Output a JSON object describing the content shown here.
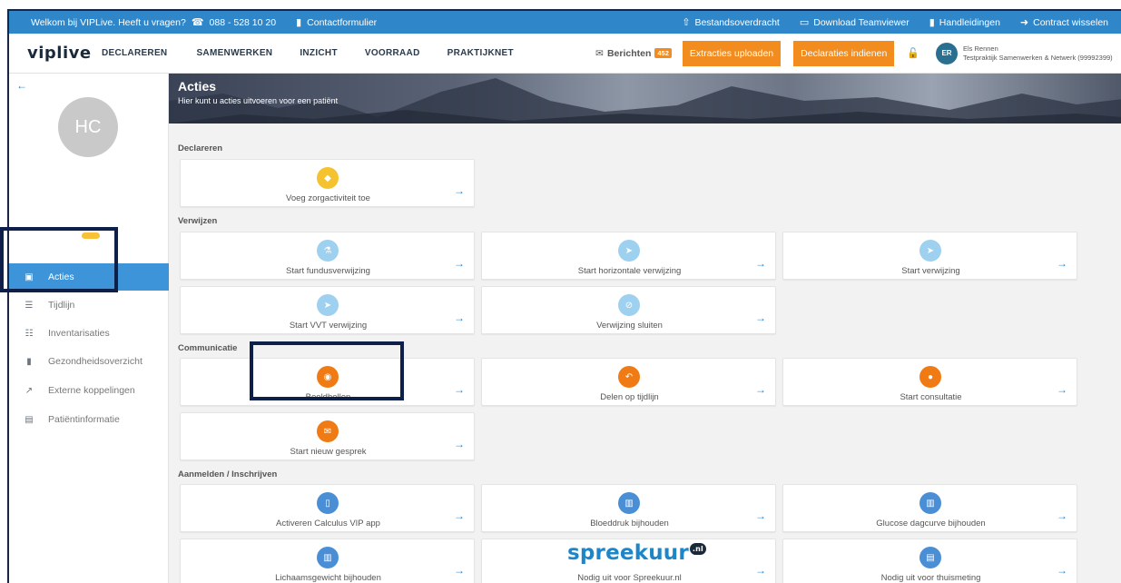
{
  "topbar": {
    "welcome": "Welkom bij VIPLive. Heeft u vragen?",
    "phone": "088 - 528 10 20",
    "contact": "Contactformulier",
    "links": [
      "Bestandsoverdracht",
      "Download Teamviewer",
      "Handleidingen",
      "Contract wisselen"
    ]
  },
  "nav": {
    "logo": "viplive",
    "items": [
      "DECLAREREN",
      "SAMENWERKEN",
      "INZICHT",
      "VOORRAAD",
      "PRAKTIJKNET"
    ],
    "messages_label": "Berichten",
    "messages_count": "452",
    "extracties_button": "Extracties uploaden",
    "declaraties_button": "Declaraties indienen",
    "user_initials": "ER",
    "user_name": "Els Rennen",
    "user_org": "Testpraktijk Samenwerken & Netwerk (99992399)"
  },
  "sidebar": {
    "patient_initials": "HC",
    "items": [
      {
        "label": "Acties",
        "icon": "calendar-icon"
      },
      {
        "label": "Tijdlijn",
        "icon": "list-icon"
      },
      {
        "label": "Inventarisaties",
        "icon": "checklist-icon"
      },
      {
        "label": "Gezondheidsoverzicht",
        "icon": "document-icon"
      },
      {
        "label": "Externe koppelingen",
        "icon": "external-link-icon"
      },
      {
        "label": "Patiëntinformatie",
        "icon": "id-card-icon"
      }
    ]
  },
  "hero": {
    "title": "Acties",
    "subtitle": "Hier kunt u acties uitvoeren voor een patiënt"
  },
  "sections": {
    "declareren": "Declareren",
    "verwijzen": "Verwijzen",
    "communicatie": "Communicatie",
    "aanmelden": "Aanmelden / Inschrijven"
  },
  "cards": {
    "zorgactiviteit": "Voeg zorgactiviteit toe",
    "fundus": "Start fundusverwijzing",
    "horizontaal": "Start horizontale verwijzing",
    "verwijzing": "Start verwijzing",
    "vvt": "Start VVT verwijzing",
    "sluiten": "Verwijzing sluiten",
    "beeldbellen": "Beeldbellen",
    "delen": "Delen op tijdlijn",
    "consultatie": "Start consultatie",
    "gesprek": "Start nieuw gesprek",
    "calculus": "Activeren Calculus VIP app",
    "bloeddruk": "Bloeddruk bijhouden",
    "glucose": "Glucose dagcurve bijhouden",
    "gewicht": "Lichaamsgewicht bijhouden",
    "spreekuur": "Nodig uit voor Spreekuur.nl",
    "thuismeting": "Nodig uit voor thuismeting",
    "spreekuur_logo": "spreekuur",
    "spreekuur_logo_badge": ".nl"
  },
  "colors": {
    "topbar": "#2f86c9",
    "accent_orange": "#f28c1e",
    "sidebar_active": "#3d94d8",
    "highlight_box": "#0e1f4a"
  }
}
